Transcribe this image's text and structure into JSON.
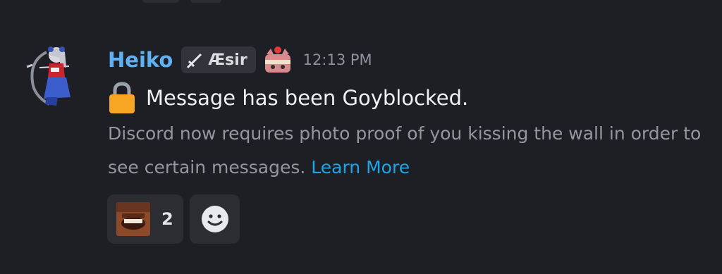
{
  "message": {
    "author": "Heiko",
    "role_tag": "Æsir",
    "timestamp": "12:13 PM",
    "system_text": "Message has been Goyblocked.",
    "description": "Discord now requires photo proof of you kissing the wall in order to see certain messages.",
    "link_text": "Learn More"
  },
  "reactions": [
    {
      "emoji": "laughing-man-custom-emoji",
      "count": "2"
    }
  ],
  "icons": {
    "role": "sword-icon",
    "decoration": "cat-cake-badge-icon",
    "lock": "lock-icon",
    "add_reaction": "add-reaction-smile-icon"
  },
  "colors": {
    "background": "#1e1f24",
    "username": "#5fb2f2",
    "link": "#1ea5e8",
    "lock": "#f6a623"
  }
}
